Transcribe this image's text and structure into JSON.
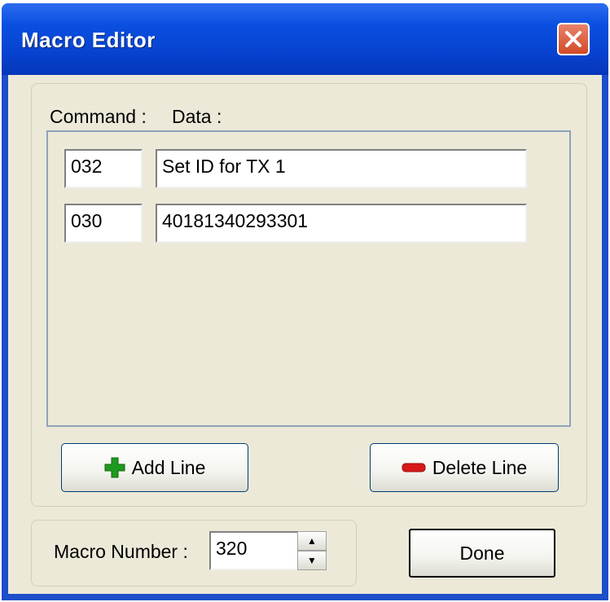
{
  "window": {
    "title": "Macro Editor"
  },
  "headers": {
    "command": "Command :",
    "data": "Data :"
  },
  "lines": [
    {
      "command": "032",
      "data": "Set ID for TX 1"
    },
    {
      "command": "030",
      "data": "40181340293301"
    }
  ],
  "buttons": {
    "add_line": "Add Line",
    "delete_line": "Delete Line",
    "done": "Done"
  },
  "macro": {
    "label": "Macro Number :",
    "value": "320"
  },
  "icons": {
    "close": "close-icon",
    "add": "plus-icon",
    "delete": "minus-icon",
    "spin_up": "arrow-up-icon",
    "spin_down": "arrow-down-icon"
  },
  "colors": {
    "title_bar": "#0a4fe0",
    "close": "#d24a28",
    "add_icon": "#1f9a1f",
    "delete_icon": "#d81818",
    "background": "#ece9d8"
  }
}
